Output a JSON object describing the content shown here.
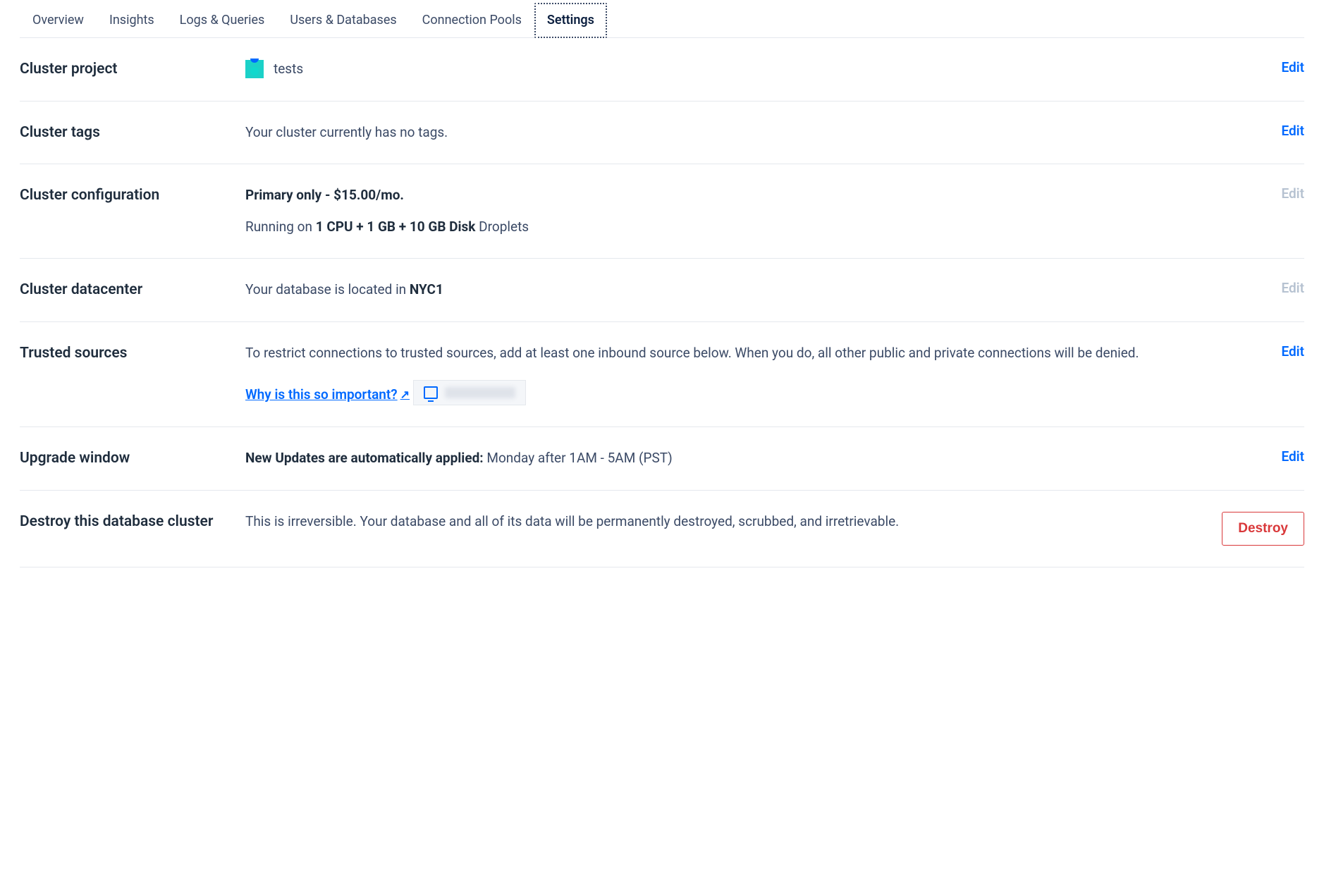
{
  "tabs": [
    {
      "label": "Overview"
    },
    {
      "label": "Insights"
    },
    {
      "label": "Logs & Queries"
    },
    {
      "label": "Users & Databases"
    },
    {
      "label": "Connection Pools"
    },
    {
      "label": "Settings",
      "active": true
    }
  ],
  "sections": {
    "project": {
      "label": "Cluster project",
      "value": "tests",
      "action": "Edit"
    },
    "tags": {
      "label": "Cluster tags",
      "value": "Your cluster currently has no tags.",
      "action": "Edit"
    },
    "configuration": {
      "label": "Cluster configuration",
      "plan": "Primary only - $15.00/mo.",
      "running_prefix": "Running on ",
      "spec": "1 CPU + 1 GB + 10 GB Disk",
      "running_suffix": " Droplets",
      "action": "Edit"
    },
    "datacenter": {
      "label": "Cluster datacenter",
      "prefix": "Your database is located in ",
      "location": "NYC1",
      "action": "Edit"
    },
    "trusted": {
      "label": "Trusted sources",
      "description": "To restrict connections to trusted sources, add at least one inbound source below. When you do, all other public and private connections will be denied.",
      "why_link": "Why is this so important?",
      "action": "Edit"
    },
    "upgrade": {
      "label": "Upgrade window",
      "bold": "New Updates are automatically applied:",
      "value": " Monday after 1AM - 5AM (PST)",
      "action": "Edit"
    },
    "destroy": {
      "label": "Destroy this database cluster",
      "description": "This is irreversible. Your database and all of its data will be permanently destroyed, scrubbed, and irretrievable.",
      "action": "Destroy"
    }
  }
}
